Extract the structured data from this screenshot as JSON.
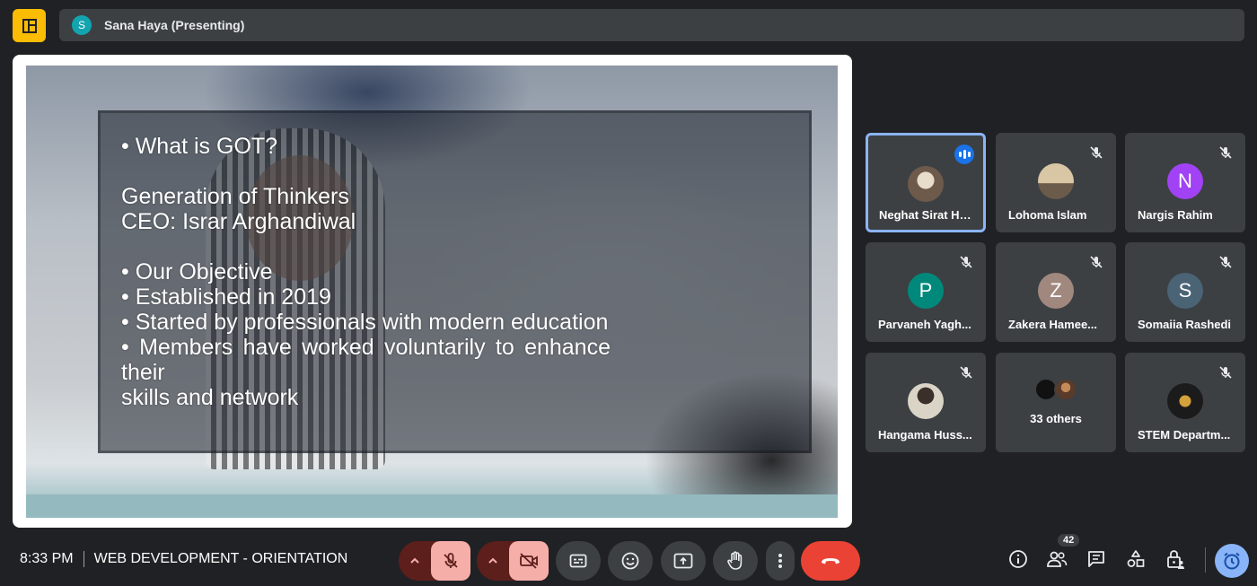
{
  "top_bar": {
    "presenter_initial": "S",
    "presenter_label": "Sana Haya (Presenting)"
  },
  "slide": {
    "lines": [
      "• What is GOT?",
      "Generation of Thinkers",
      "CEO: Israr Arghandiwal",
      "• Our Objective",
      "• Established in 2019",
      "• Started by professionals with modern education",
      "• Members have worked voluntarily to enhance their",
      "skills and network"
    ]
  },
  "participants": [
    {
      "name": "Neghat Sirat Ha...",
      "initial": "",
      "color": "#8d7b6a",
      "state": "speaking"
    },
    {
      "name": "Lohoma Islam",
      "initial": "",
      "color": "#c9a06a",
      "state": "muted"
    },
    {
      "name": "Nargis Rahim",
      "initial": "N",
      "color": "#a142f4",
      "state": "muted"
    },
    {
      "name": "Parvaneh Yagh...",
      "initial": "P",
      "color": "#00897b",
      "state": "muted"
    },
    {
      "name": "Zakera Hamee...",
      "initial": "Z",
      "color": "#a1887f",
      "state": "muted"
    },
    {
      "name": "Somaiia Rashedi",
      "initial": "S",
      "color": "#4a6375",
      "state": "muted"
    },
    {
      "name": "Hangama Huss...",
      "initial": "",
      "color": "#d7d2c4",
      "state": "muted"
    },
    {
      "name": "33 others",
      "initial": "",
      "color": "",
      "state": "others"
    },
    {
      "name": "STEM Departm...",
      "initial": "",
      "color": "#1b1b1b",
      "state": "muted"
    }
  ],
  "bottom_bar": {
    "time": "8:33 PM",
    "meeting_title": "WEB DEVELOPMENT - ORIENTATION",
    "people_count": "42"
  },
  "colors": {
    "background": "#202124",
    "surface": "#3c4043",
    "danger": "#ea4335",
    "muted_bg": "#f6aea9",
    "accent": "#8ab4f8",
    "side_toggle": "#fbbc04"
  }
}
